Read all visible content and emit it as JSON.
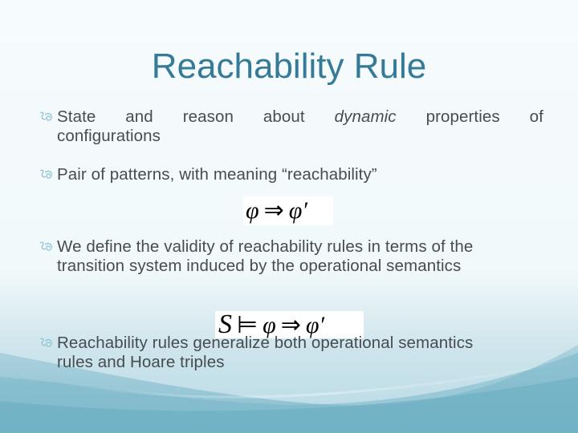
{
  "slide": {
    "title": "Reachability Rule",
    "bullet_icon": "flourish-bullet-icon",
    "bullets": [
      {
        "words_line1": [
          "State",
          "and",
          "reason",
          "about",
          "dynamic",
          "properties",
          "of"
        ],
        "italic_word": "dynamic",
        "line2": "configurations"
      },
      {
        "text": "Pair of patterns, with meaning “reachability”"
      },
      {
        "line1": "We define the validity of reachability rules in terms of the",
        "line2": "transition system induced by the operational semantics"
      },
      {
        "line1": "Reachability rules generalize both operational semantics",
        "line2": "rules and Hoare triples"
      }
    ],
    "formula1": {
      "lhs": "φ",
      "op": "⇒",
      "rhs": "φ′"
    },
    "formula2": {
      "S": "S",
      "models": "⊨",
      "lhs": "φ",
      "op": "⇒",
      "rhs": "φ′"
    }
  },
  "theme": {
    "title_color": "#357b98",
    "text_color": "#464c50",
    "wave_color": "#6fb0c4"
  }
}
